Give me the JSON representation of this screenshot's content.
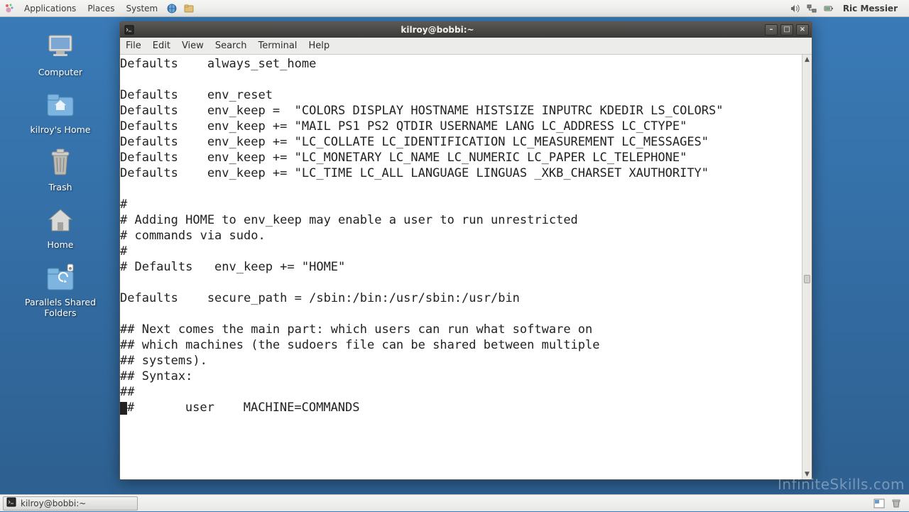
{
  "top_panel": {
    "menus": [
      "Applications",
      "Places",
      "System"
    ],
    "launchers": [
      "web-browser-icon",
      "file-manager-icon"
    ],
    "tray": [
      "sound-icon",
      "network-icon",
      "battery-icon"
    ],
    "user": "Ric Messier"
  },
  "desktop_icons": [
    {
      "name": "computer",
      "label": "Computer",
      "icon": "computer-icon"
    },
    {
      "name": "home",
      "label": "kilroy's Home",
      "icon": "home-folder-icon"
    },
    {
      "name": "trash",
      "label": "Trash",
      "icon": "trash-icon"
    },
    {
      "name": "home2",
      "label": "Home",
      "icon": "home-icon"
    },
    {
      "name": "shared",
      "label": "Parallels Shared Folders",
      "icon": "shared-folder-icon"
    }
  ],
  "window": {
    "title": "kilroy@bobbi:~",
    "menus": [
      "File",
      "Edit",
      "View",
      "Search",
      "Terminal",
      "Help"
    ],
    "content": "Defaults    always_set_home\n\nDefaults    env_reset\nDefaults    env_keep =  \"COLORS DISPLAY HOSTNAME HISTSIZE INPUTRC KDEDIR LS_COLORS\"\nDefaults    env_keep += \"MAIL PS1 PS2 QTDIR USERNAME LANG LC_ADDRESS LC_CTYPE\"\nDefaults    env_keep += \"LC_COLLATE LC_IDENTIFICATION LC_MEASUREMENT LC_MESSAGES\"\nDefaults    env_keep += \"LC_MONETARY LC_NAME LC_NUMERIC LC_PAPER LC_TELEPHONE\"\nDefaults    env_keep += \"LC_TIME LC_ALL LANGUAGE LINGUAS _XKB_CHARSET XAUTHORITY\"\n\n#\n# Adding HOME to env_keep may enable a user to run unrestricted\n# commands via sudo.\n#\n# Defaults   env_keep += \"HOME\"\n\nDefaults    secure_path = /sbin:/bin:/usr/sbin:/usr/bin\n\n## Next comes the main part: which users can run what software on \n## which machines (the sudoers file can be shared between multiple\n## systems).\n## Syntax:\n##\n",
    "lastline_after_cursor": "#       user    MACHINE=COMMANDS"
  },
  "taskbar": {
    "active_task": "kilroy@bobbi:~"
  },
  "watermark": "InfiniteSkills.com"
}
